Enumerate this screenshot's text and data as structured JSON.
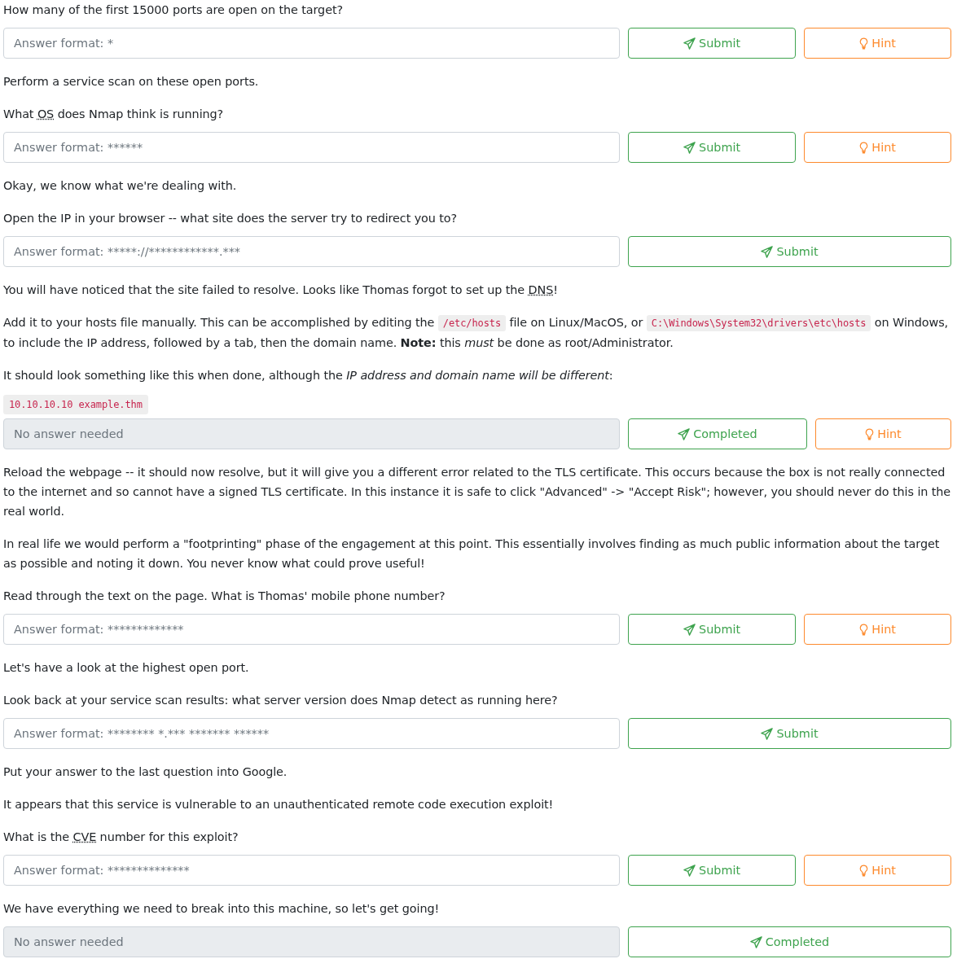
{
  "blocks": [
    {
      "kind": "paragraph",
      "parts": [
        {
          "kind": "text",
          "text": "How many of the first 15000 ports are open on the target?"
        }
      ]
    },
    {
      "kind": "question",
      "placeholder": "Answer format: *",
      "disabled": false,
      "submit": "Submit",
      "hint": "Hint"
    },
    {
      "kind": "paragraph",
      "parts": [
        {
          "kind": "text",
          "text": "Perform a service scan on these open ports."
        }
      ]
    },
    {
      "kind": "paragraph",
      "parts": [
        {
          "kind": "text",
          "text": "What "
        },
        {
          "kind": "abbr",
          "text": "OS"
        },
        {
          "kind": "text",
          "text": " does Nmap think is running?"
        }
      ]
    },
    {
      "kind": "question",
      "placeholder": "Answer format: ******",
      "disabled": false,
      "submit": "Submit",
      "hint": "Hint"
    },
    {
      "kind": "paragraph",
      "parts": [
        {
          "kind": "text",
          "text": "Okay, we know what we're dealing with."
        }
      ]
    },
    {
      "kind": "paragraph",
      "parts": [
        {
          "kind": "text",
          "text": "Open the IP in your browser -- what site does the server try to redirect you to?"
        }
      ]
    },
    {
      "kind": "question",
      "placeholder": "Answer format: *****://************.***",
      "disabled": false,
      "submit": "Submit"
    },
    {
      "kind": "paragraph",
      "parts": [
        {
          "kind": "text",
          "text": "You will have noticed that the site failed to resolve. Looks like Thomas forgot to set up the "
        },
        {
          "kind": "abbr",
          "text": "DNS"
        },
        {
          "kind": "text",
          "text": "!"
        }
      ]
    },
    {
      "kind": "paragraph",
      "parts": [
        {
          "kind": "text",
          "text": "Add it to your hosts file manually. This can be accomplished by editing the "
        },
        {
          "kind": "code",
          "text": "/etc/hosts"
        },
        {
          "kind": "text",
          "text": " file on Linux/MacOS, or "
        },
        {
          "kind": "code",
          "text": "C:\\Windows\\System32\\drivers\\etc\\hosts"
        },
        {
          "kind": "text",
          "text": " on Windows, to include the IP address, followed by a tab, then the domain name. **Note:** this *must* be done as root/Administrator."
        }
      ]
    },
    {
      "kind": "paragraph",
      "parts": [
        {
          "kind": "text",
          "text": "It should look something like this when done, although the *IP address and domain name will be different*:"
        }
      ]
    },
    {
      "kind": "code",
      "text": "10.10.10.10 example.thm"
    },
    {
      "kind": "question",
      "placeholder": "No answer needed",
      "disabled": true,
      "submit": "Completed",
      "hint": "Hint"
    },
    {
      "kind": "paragraph",
      "parts": [
        {
          "kind": "text",
          "text": "Reload the webpage -- it should now resolve, but it will give you a different error related to the TLS certificate. This occurs because the box is not really connected to the internet and so cannot have a signed TLS certificate. In this instance it is safe to click \"Advanced\" -> \"Accept Risk\"; however, you should never do this in the real world."
        }
      ]
    },
    {
      "kind": "paragraph",
      "parts": [
        {
          "kind": "text",
          "text": "In real life we would perform a \"footprinting\" phase of the engagement at this point. This essentially involves finding as much public information about the target as possible and noting it down. You never know what could prove useful!"
        }
      ]
    },
    {
      "kind": "paragraph",
      "parts": [
        {
          "kind": "text",
          "text": "Read through the text on the page. What is Thomas' mobile phone number?"
        }
      ]
    },
    {
      "kind": "question",
      "placeholder": "Answer format: *************",
      "disabled": false,
      "submit": "Submit",
      "hint": "Hint"
    },
    {
      "kind": "paragraph",
      "parts": [
        {
          "kind": "text",
          "text": "Let's have a look at the highest open port."
        }
      ]
    },
    {
      "kind": "paragraph",
      "parts": [
        {
          "kind": "text",
          "text": "Look back at your service scan results: what server version does Nmap detect as running here?"
        }
      ]
    },
    {
      "kind": "question",
      "placeholder": "Answer format: ******** *.*** ******* ******",
      "disabled": false,
      "submit": "Submit"
    },
    {
      "kind": "paragraph",
      "parts": [
        {
          "kind": "text",
          "text": "Put your answer to the last question into Google."
        }
      ]
    },
    {
      "kind": "paragraph",
      "parts": [
        {
          "kind": "text",
          "text": "It appears that this service is vulnerable to an unauthenticated remote code execution exploit!"
        }
      ]
    },
    {
      "kind": "paragraph",
      "parts": [
        {
          "kind": "text",
          "text": "What is the "
        },
        {
          "kind": "abbr",
          "text": "CVE"
        },
        {
          "kind": "text",
          "text": " number for this exploit?"
        }
      ]
    },
    {
      "kind": "question",
      "placeholder": "Answer format: **************",
      "disabled": false,
      "submit": "Submit",
      "hint": "Hint"
    },
    {
      "kind": "paragraph",
      "parts": [
        {
          "kind": "text",
          "text": "We have everything we need to break into this machine, so let's get going!"
        }
      ]
    },
    {
      "kind": "question",
      "placeholder": "No answer needed",
      "disabled": true,
      "submit": "Completed"
    }
  ]
}
